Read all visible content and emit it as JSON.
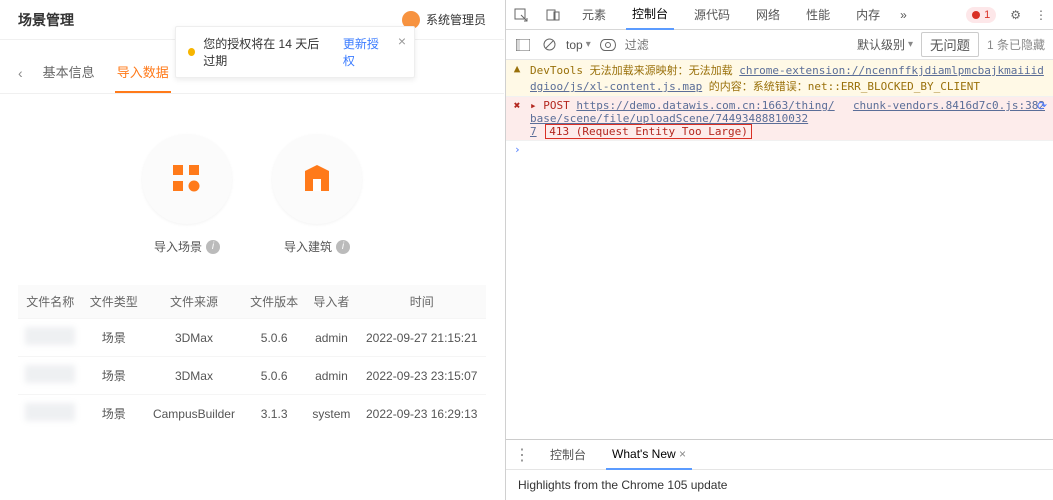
{
  "app": {
    "title": "场景管理",
    "admin_label": "系统管理员"
  },
  "toast": {
    "message": "您的授权将在 14 天后过期",
    "action": "更新授权"
  },
  "tabs": {
    "back_glyph": "‹",
    "items": [
      {
        "label": "基本信息",
        "active": false
      },
      {
        "label": "导入数据",
        "active": true
      }
    ]
  },
  "import_cards": [
    {
      "label": "导入场景",
      "icon": "grid-icon"
    },
    {
      "label": "导入建筑",
      "icon": "building-icon"
    }
  ],
  "table": {
    "headers": [
      "文件名称",
      "文件类型",
      "文件来源",
      "文件版本",
      "导入者",
      "时间"
    ],
    "rows": [
      {
        "type": "场景",
        "source": "3DMax",
        "version": "5.0.6",
        "importer": "admin",
        "time": "2022-09-27 21:15:21"
      },
      {
        "type": "场景",
        "source": "3DMax",
        "version": "5.0.6",
        "importer": "admin",
        "time": "2022-09-23 23:15:07"
      },
      {
        "type": "场景",
        "source": "CampusBuilder",
        "version": "3.1.3",
        "importer": "system",
        "time": "2022-09-23 16:29:13"
      }
    ]
  },
  "devtools": {
    "tabs": [
      "元素",
      "控制台",
      "源代码",
      "网络",
      "性能",
      "内存"
    ],
    "active_tab_index": 1,
    "more_glyph": "»",
    "error_count": "1",
    "subbar": {
      "context": "top",
      "filter_placeholder": "过滤",
      "level": "默认级别",
      "issues": "无问题",
      "hidden_text": "1 条已隐藏"
    },
    "messages": {
      "warn_text_prefix": "DevTools 无法加载来源映射：无法加载 ",
      "warn_url": "chrome-extension://ncennffkjdiamlpmcbajkmaiiiddgioo/js/xl-content.js.map",
      "warn_text_suffix": " 的内容：系统错误：net::ERR_BLOCKED_BY_CLIENT",
      "err_method": "POST",
      "err_url": "https://demo.datawis.com.cn:1663/thing/base/scene/file/uploadScene/74493488810032",
      "err_url_tail": "7",
      "err_status": "413 (Request Entity Too Large)",
      "err_source": "chunk-vendors.8416d7c0.js:382"
    },
    "drawer": {
      "tabs": [
        "控制台",
        "What's New"
      ],
      "active_index": 1,
      "headline": "Highlights from the Chrome 105 update"
    }
  }
}
